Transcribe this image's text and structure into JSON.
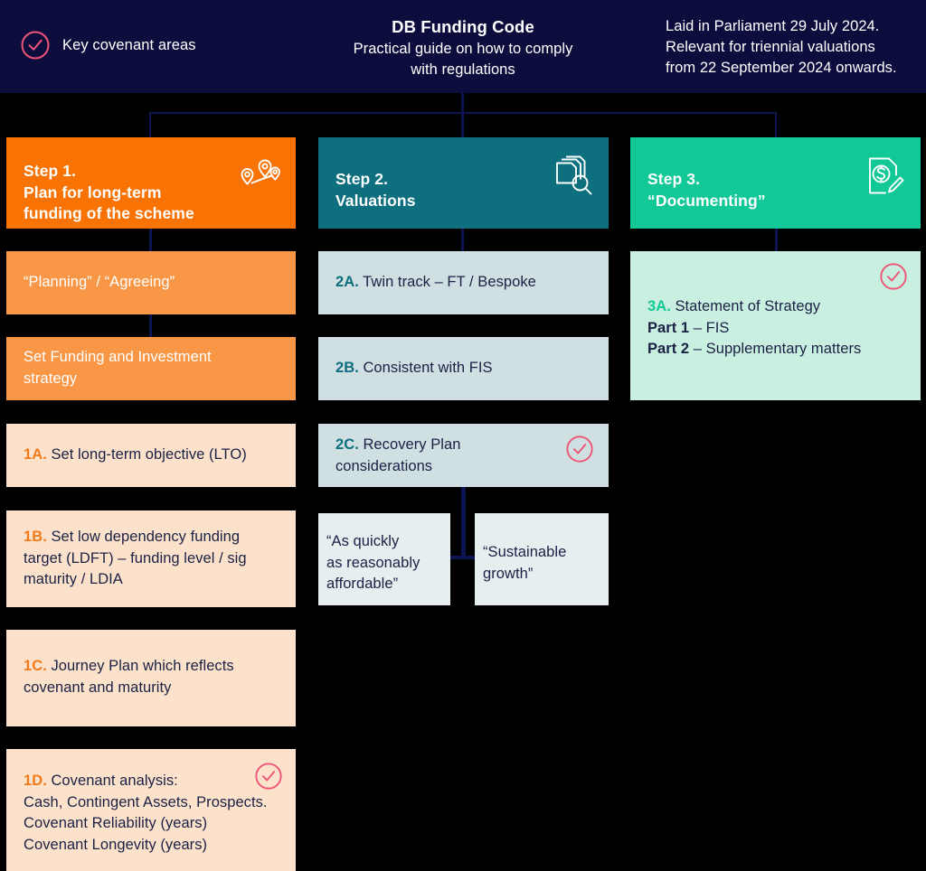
{
  "header": {
    "legend_label": "Key covenant areas",
    "legend_icon": "check-circle-icon",
    "title": "DB Funding Code",
    "subtitle_line1": "Practical guide on how to comply",
    "subtitle_line2": "with regulations",
    "note_line1": "Laid in Parliament 29 July 2024.",
    "note_line2": "Relevant for triennial valuations",
    "note_line3": "from 22 September 2024 onwards.",
    "background_color": "#0C0C3D",
    "accent_pink": "#EE5577"
  },
  "columns": [
    {
      "id": "step-1",
      "header": {
        "line1": "Step 1.",
        "line2": "Plan for long-term",
        "line3": "funding of the scheme",
        "icon": "map-pins-icon",
        "color": "#F97304"
      },
      "items": [
        {
          "id": "planning-agreeing",
          "text": "“Planning” / “Agreeing”",
          "bg": "#F99746",
          "text_color": "#FFFFFF",
          "check": false
        },
        {
          "id": "set-fis",
          "line1": "Set Funding and Investment",
          "line2": "strategy",
          "bg": "#F99746",
          "text_color": "#FFFFFF",
          "check": false
        },
        {
          "id": "1a",
          "label": "1A.",
          "line1": "Set long-term objective (LTO)",
          "bg": "#FCE2CB",
          "check": false
        },
        {
          "id": "1b",
          "label": "1B.",
          "line1": "Set low dependency funding",
          "line2": "target (LDFT) – funding level / sig",
          "line3": "maturity / LDIA",
          "bg": "#FCE2CB",
          "check": false
        },
        {
          "id": "1c",
          "label": "1C.",
          "line1": "Journey Plan which reflects",
          "line2": "covenant and maturity",
          "bg": "#FCE2CB",
          "check": false
        },
        {
          "id": "1d",
          "label": "1D.",
          "line1": "Covenant analysis:",
          "line2": "Cash, Contingent Assets, Prospects.",
          "line3": "Covenant Reliability (years)",
          "line4": "Covenant Longevity (years)",
          "bg": "#FCE2CB",
          "check": true
        }
      ]
    },
    {
      "id": "step-2",
      "header": {
        "line1": "Step 2.",
        "line2": "Valuations",
        "icon": "documents-search-icon",
        "color": "#0E6F7E"
      },
      "items": [
        {
          "id": "2a",
          "label": "2A.",
          "line1": "Twin track – FT / Bespoke",
          "bg": "#CFDFE2",
          "check": false
        },
        {
          "id": "2b",
          "label": "2B.",
          "line1": "Consistent with FIS",
          "bg": "#CFDFE2",
          "check": false
        },
        {
          "id": "2c",
          "label": "2C.",
          "line1": "Recovery Plan",
          "line2": "considerations",
          "bg": "#CFDFE2",
          "check": true
        }
      ],
      "quotes": [
        {
          "id": "quote-affordable",
          "line1": "“As quickly",
          "line2": "as reasonably",
          "line3": "affordable”",
          "bg": "#E7EEEF"
        },
        {
          "id": "quote-sustainable",
          "line1": "“Sustainable",
          "line2": "growth”",
          "bg": "#E7EEEF"
        }
      ]
    },
    {
      "id": "step-3",
      "header": {
        "line1": "Step 3.",
        "line2": "“Documenting”",
        "icon": "document-dollar-pencil-icon",
        "color": "#12C896"
      },
      "items": [
        {
          "id": "3a",
          "label": "3A.",
          "line1": "Statement of Strategy",
          "part1_label": "Part 1",
          "part1_text": " – FIS",
          "part2_label": "Part 2",
          "part2_text": " – Supplementary matters",
          "bg": "#C9EFE0",
          "check": true
        }
      ]
    }
  ]
}
